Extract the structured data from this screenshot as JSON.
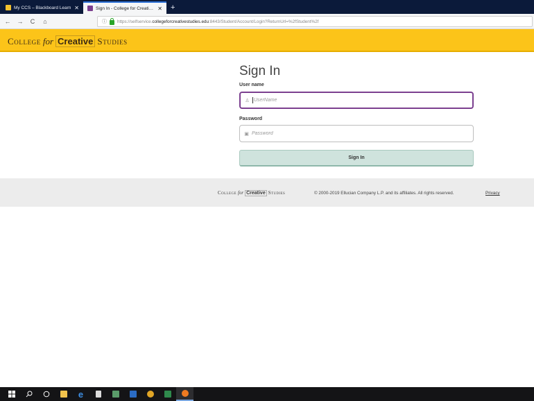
{
  "browser": {
    "tabs": [
      {
        "title": "My CCS – Blackboard Learn",
        "favicon_color": "#f2c12e",
        "active": false
      },
      {
        "title": "Sign In - College for Creative S",
        "favicon_color": "#7b3f8f",
        "active": true
      }
    ],
    "new_tab_label": "+",
    "nav": {
      "back": "←",
      "forward": "→",
      "reload": "C",
      "home": "⌂"
    },
    "url": {
      "prefix": "https://selfservice.",
      "host": "collegeforcreativestudies.edu",
      "suffix": ":8443/Student/Account/Login?ReturnUrl=%2fStudent%2f"
    }
  },
  "header": {
    "logo": {
      "word1": "College",
      "word2": "for",
      "word3": "Creative",
      "word4": "Studies"
    },
    "background": "#fcc419"
  },
  "form": {
    "title": "Sign In",
    "username_label": "User name",
    "username_placeholder": "UserName",
    "password_label": "Password",
    "password_placeholder": "Password",
    "submit_label": "Sign In",
    "focus_color": "#7b3f8f",
    "button_color": "#cfe3dd"
  },
  "footer": {
    "logo": {
      "word1": "College",
      "word2": "for",
      "word3": "Creative",
      "word4": "Studies"
    },
    "copyright": "© 2000-2019 Ellucian Company L.P. and its affiliates. All rights reserved.",
    "privacy_label": "Privacy"
  },
  "taskbar": {
    "items": [
      {
        "name": "windows-start",
        "icon": "windows-logo-icon",
        "color": "#ffffff"
      },
      {
        "name": "search",
        "icon": "search-icon",
        "color": "#ffffff"
      },
      {
        "name": "task-view",
        "icon": "task-view-icon",
        "color": "#ffffff"
      },
      {
        "name": "file-explorer",
        "icon": "folder-icon",
        "color": "#f2c34c"
      },
      {
        "name": "edge",
        "icon": "edge-icon",
        "color": "#3d8ee3"
      },
      {
        "name": "calculator",
        "icon": "calculator-icon",
        "color": "#dcdcdc"
      },
      {
        "name": "app-green",
        "icon": "app-icon",
        "color": "#5a9c6a"
      },
      {
        "name": "word",
        "icon": "word-icon",
        "color": "#2b6cc4"
      },
      {
        "name": "chrome",
        "icon": "chrome-icon",
        "color": "#e0a526"
      },
      {
        "name": "excel",
        "icon": "excel-icon",
        "color": "#2f8a4c"
      },
      {
        "name": "firefox",
        "icon": "firefox-icon",
        "color": "#ef7b21",
        "active": true
      }
    ]
  }
}
